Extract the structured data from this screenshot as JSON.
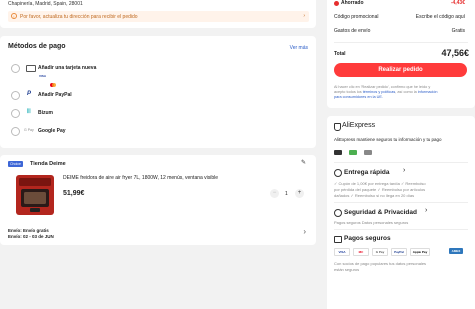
{
  "address": {
    "line": "Chapinería, Madrid, Spain, 28001",
    "warning": "Por favor, actualiza tu dirección para recibir el pedido",
    "warning_arrow": "›"
  },
  "payment": {
    "title": "Métodos de pago",
    "see_more": "Ver más",
    "methods": [
      {
        "label": "Añadir una tarjeta nueva",
        "icon": "credit-card-icon"
      },
      {
        "label": "Añadir PayPal",
        "icon": "paypal-icon"
      },
      {
        "label": "Bizum",
        "icon": "bizum-icon"
      },
      {
        "label": "Google Pay",
        "icon": "google-pay-icon"
      }
    ],
    "card_brands": [
      "VISA",
      "MC"
    ],
    "gpay_badge": "G Pay"
  },
  "store": {
    "badge": "Choice",
    "name": "Tienda Deime",
    "product_title": "DEIME freidora de aire air fryer 7L, 1800W, 12 menús, ventana visible",
    "price": "51,99€",
    "qty": "1",
    "minus": "−",
    "plus": "+",
    "shipping_line1": "Envío: Envío gratis",
    "shipping_line2": "Envío: 02 - 03 de JUN",
    "arrow": "›"
  },
  "summary": {
    "saved_label": "Ahorrado",
    "saved_value": "-4,43€",
    "promo_label": "Código promocional",
    "promo_value": "Escribe el código aquí",
    "shipping_label": "Gastos de envío",
    "shipping_value": "Gratis",
    "total_label": "Total",
    "total_value": "47,56€",
    "order_button": "Realizar pedido",
    "legal_1": "Al hacer clic en 'Realizar pedido', confirmo que he leído y",
    "legal_2a": "acepto todos los ",
    "legal_2b": "términos y políticas",
    "legal_2c": ", así como la ",
    "legal_2d": "información",
    "legal_3": "para consumidores en la UE."
  },
  "trust": {
    "logo": "AliExpress",
    "tagline": "AliExpress mantiene seguros tu información y tu pago",
    "delivery_title": "Entrega rápida",
    "delivery_text_1": "✓ Cupón de 1,00€ por entrega tardía  ✓ Reembolso",
    "delivery_text_2": "por pérdida del paquete  ✓ Reembolso por artículos",
    "delivery_text_3": "dañados  ✓ Reembolso si no llega en 20 días",
    "security_title": "Seguridad & Privacidad",
    "security_text": "Pagos seguros   Datos personales seguros",
    "pay_title": "Pagos seguros",
    "pay_logos": [
      "VISA",
      "MC",
      "G Pay",
      "PayPal",
      "Apple Pay",
      "AMEX"
    ],
    "pay_text_1": "Con socios de pago populares tus datos personales",
    "pay_text_2": "están seguros",
    "chevron": "›"
  },
  "colors": {
    "accent": "#ff3b3b",
    "link": "#2a5cc7",
    "warning_bg": "#fff3ea"
  }
}
